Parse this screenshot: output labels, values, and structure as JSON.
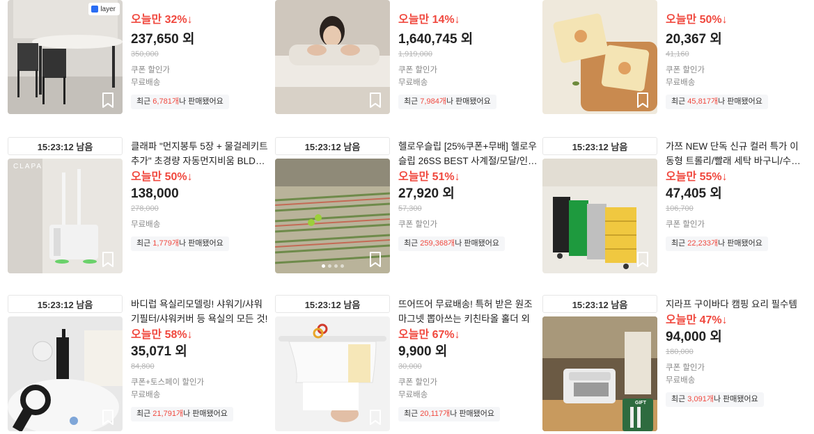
{
  "colors": {
    "discount": "#f0483e",
    "sold_bg": "#f5f6f8",
    "accent_badge": "#2a6df4"
  },
  "cards": [
    {
      "timer": "",
      "title": "",
      "discount": "오늘만 32%↓",
      "price": "237,650 외",
      "original_price": "350,000",
      "benefits": [
        "쿠폰 할인가",
        "무료배송"
      ],
      "sold_prefix": "최근 ",
      "sold_count": "6,781개",
      "sold_suffix": "나 판매됐어요",
      "badge": "layer"
    },
    {
      "timer": "",
      "title": "",
      "discount": "오늘만 14%↓",
      "price": "1,640,745 외",
      "original_price": "1,919,000",
      "benefits": [
        "쿠폰 할인가",
        "무료배송"
      ],
      "sold_prefix": "최근 ",
      "sold_count": "7,984개",
      "sold_suffix": "나 판매됐어요"
    },
    {
      "timer": "",
      "title": "",
      "discount": "오늘만 50%↓",
      "price": "20,367 외",
      "original_price": "41,160",
      "benefits": [
        "쿠폰 할인가",
        "무료배송"
      ],
      "sold_prefix": "최근 ",
      "sold_count": "45,817개",
      "sold_suffix": "나 판매됐어요"
    },
    {
      "timer": "15:23:12 남음",
      "title": "클래파 \"먼지봉투 5장 + 물걸레키트 추가\" 초경량 자동먼지비움 BLDC무선청소기",
      "discount": "오늘만 50%↓",
      "price": "138,000",
      "original_price": "278,000",
      "benefits": [
        "무료배송"
      ],
      "sold_prefix": "최근 ",
      "sold_count": "1,779개",
      "sold_suffix": "나 판매됐어요"
    },
    {
      "timer": "15:23:12 남음",
      "title": "헬로우슬립 [25%쿠폰+무배] 헬로우슬립 26SS BEST 사계절/모달/인견 침구",
      "discount": "오늘만 51%↓",
      "price": "27,920 외",
      "original_price": "57,300",
      "benefits": [
        "쿠폰 할인가"
      ],
      "sold_prefix": "최근 ",
      "sold_count": "259,368개",
      "sold_suffix": "나 판매됐어요"
    },
    {
      "timer": "15:23:12 남음",
      "title": "가쯔 NEW 단독 신규 컬러 특가 이동형 트롤리/빨래 세탁 바구니/수납장",
      "discount": "오늘만 55%↓",
      "price": "47,405 외",
      "original_price": "106,700",
      "benefits": [
        "쿠폰 할인가"
      ],
      "sold_prefix": "최근 ",
      "sold_count": "22,233개",
      "sold_suffix": "나 판매됐어요"
    },
    {
      "timer": "15:23:12 남음",
      "title": "바디럽 욕실리모델링! 샤워기/샤워기필터/샤워커버 등 욕실의 모든 것!",
      "discount": "오늘만 58%↓",
      "price": "35,071 외",
      "original_price": "84,800",
      "benefits": [
        "쿠폰+토스페이 할인가",
        "무료배송"
      ],
      "sold_prefix": "최근 ",
      "sold_count": "21,791개",
      "sold_suffix": "나 판매됐어요"
    },
    {
      "timer": "15:23:12 남음",
      "title": "뜨어뜨어 무료배송! 특허 받은 원조 마그넷 뽑아쓰는 키친타올 홀더 외",
      "discount": "오늘만 67%↓",
      "price": "9,900 외",
      "original_price": "30,000",
      "benefits": [
        "쿠폰 할인가",
        "무료배송"
      ],
      "sold_prefix": "최근 ",
      "sold_count": "20,117개",
      "sold_suffix": "나 판매됐어요"
    },
    {
      "timer": "15:23:12 남음",
      "title": "지라프 구이바다 캠핑 요리 필수템",
      "discount": "오늘만 47%↓",
      "price": "94,000 외",
      "original_price": "180,000",
      "benefits": [
        "쿠폰 할인가",
        "무료배송"
      ],
      "sold_prefix": "최근 ",
      "sold_count": "3,091개",
      "sold_suffix": "나 판매됐어요",
      "gift": "GIFT"
    }
  ]
}
